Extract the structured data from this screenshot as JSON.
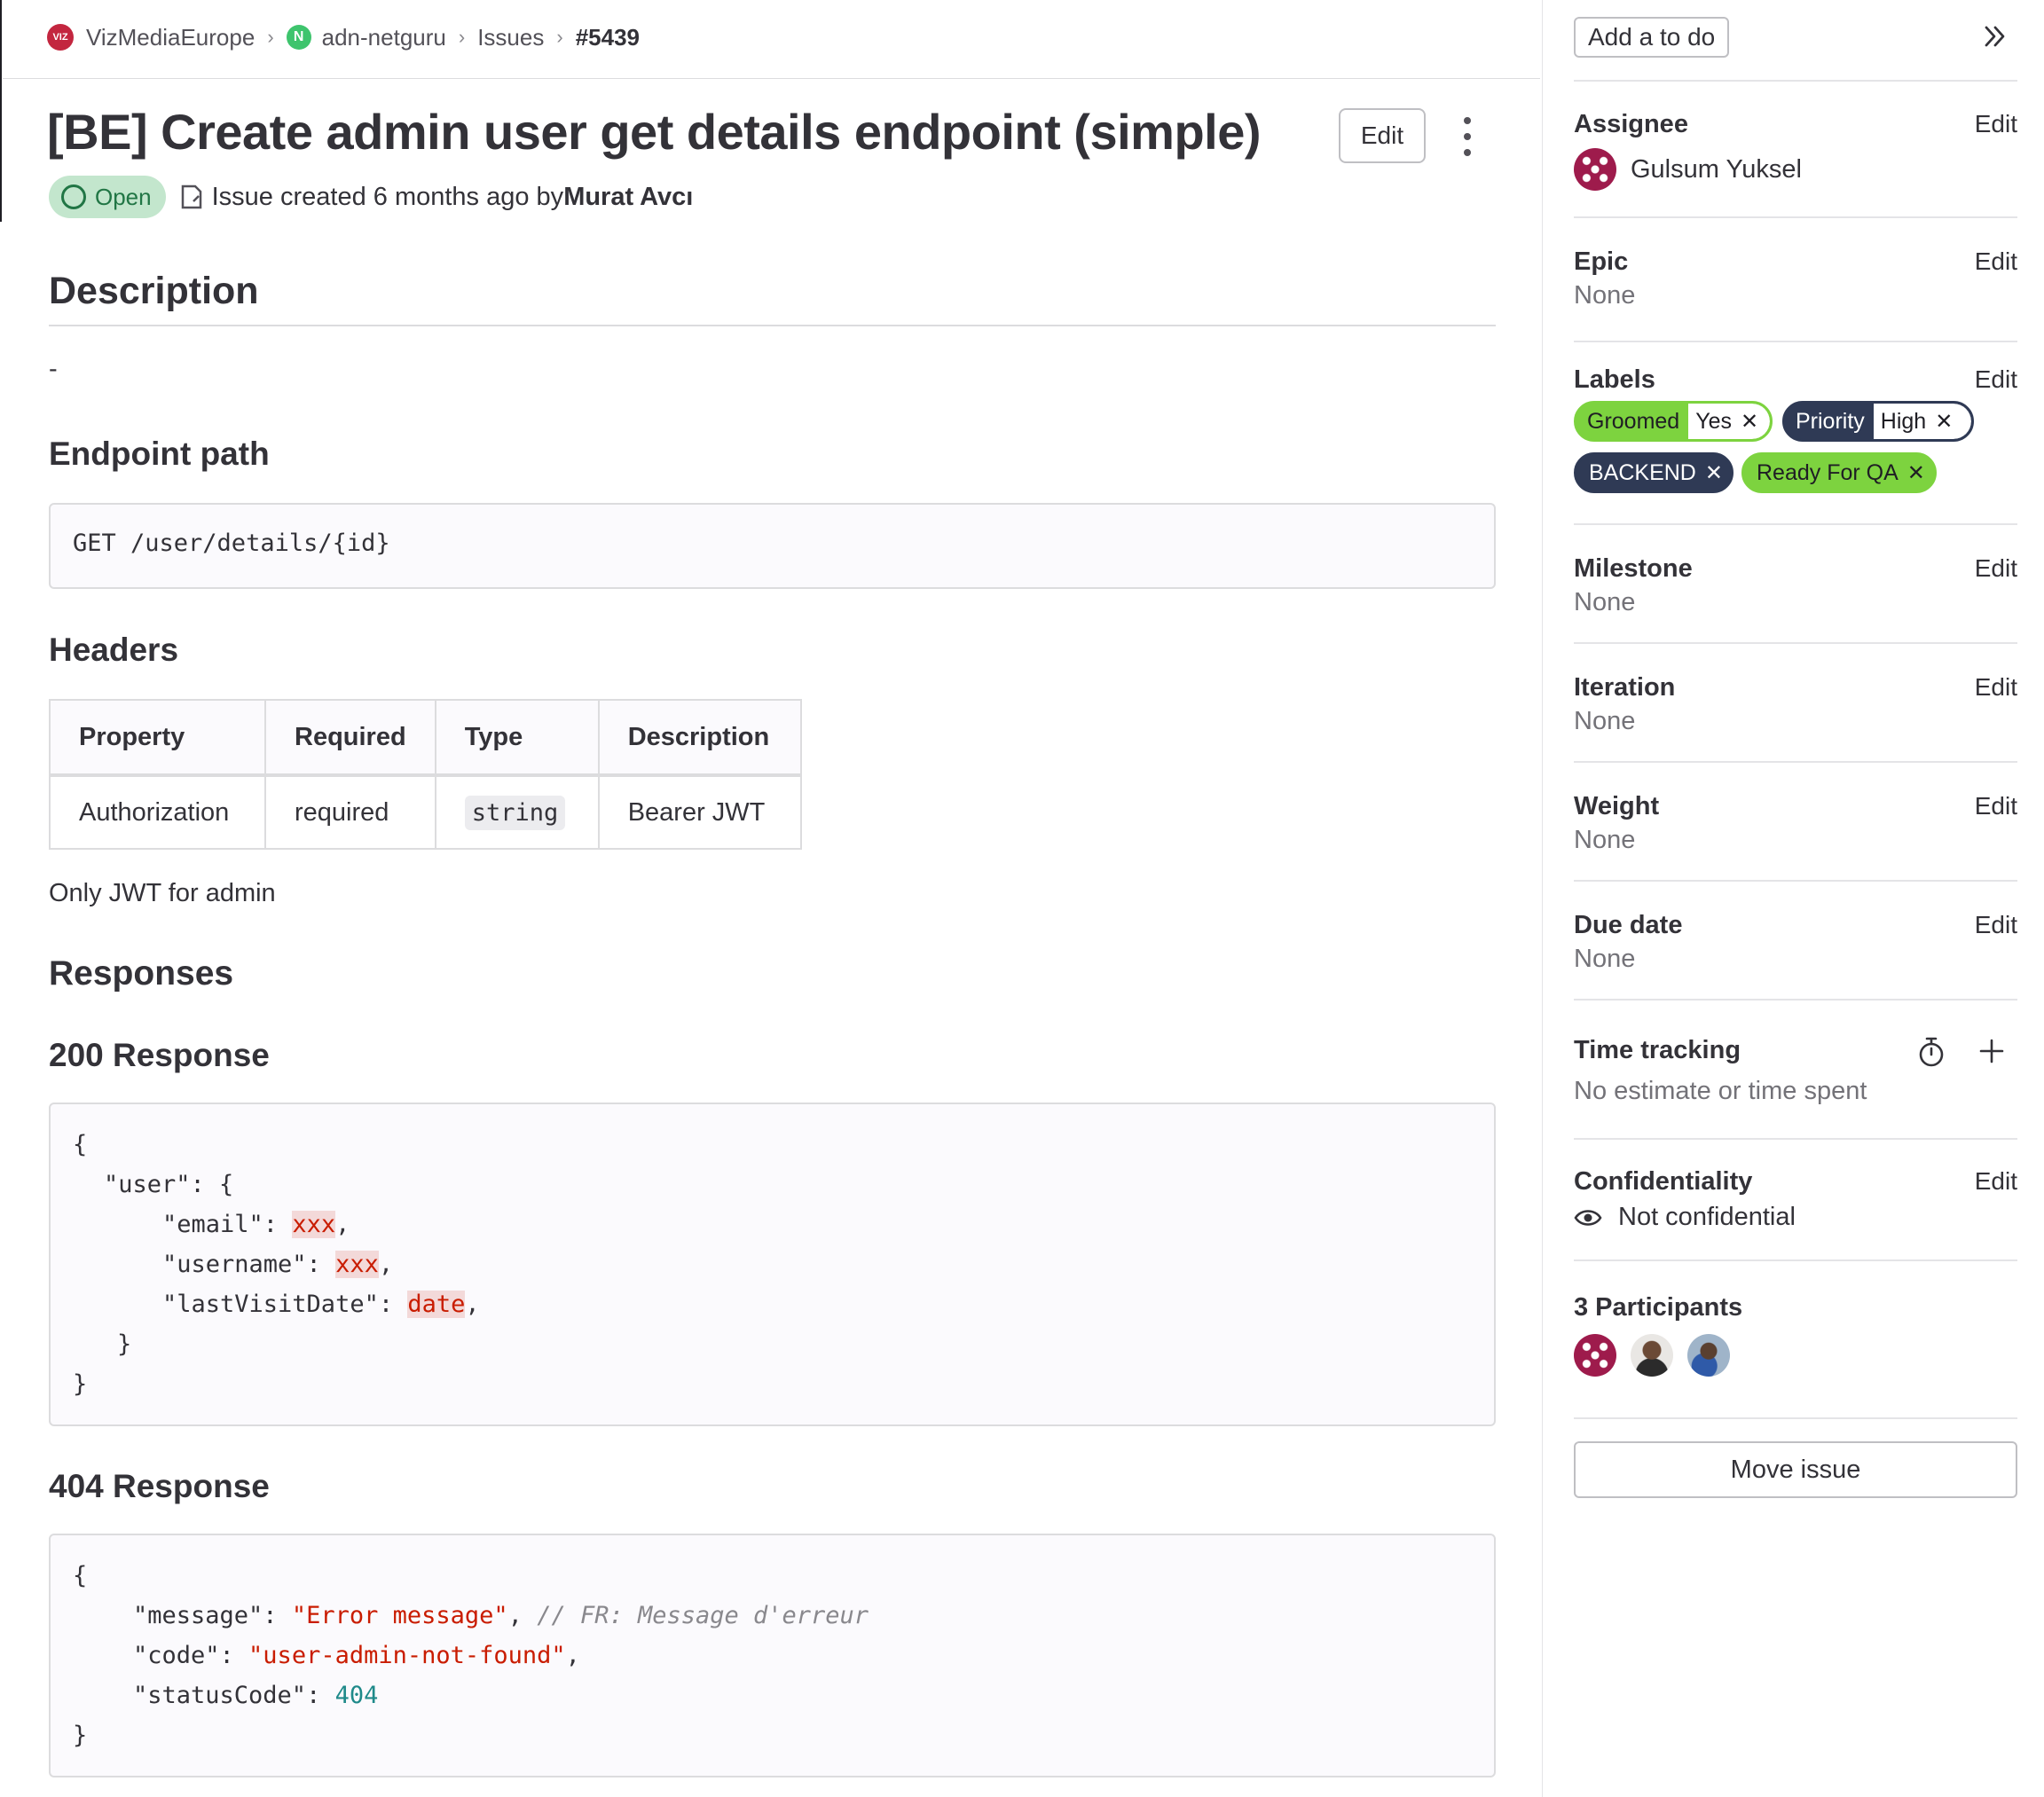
{
  "breadcrumb": {
    "group": "VizMediaEurope",
    "group_logo_text": "VIZ",
    "project": "adn-netguru",
    "project_initial": "N",
    "section": "Issues",
    "issue_ref": "#5439"
  },
  "issue": {
    "title": "[BE] Create admin user get details endpoint (simple)",
    "edit_label": "Edit",
    "status": "Open",
    "created_text": "Issue created 6 months ago by ",
    "author": "Murat Avcı"
  },
  "description": {
    "heading": "Description",
    "dash": "-",
    "endpoint_heading": "Endpoint path",
    "endpoint_code": "GET /user/details/{id}",
    "headers_heading": "Headers",
    "table": {
      "columns": [
        "Property",
        "Required",
        "Type",
        "Description"
      ],
      "rows": [
        [
          "Authorization",
          "required",
          "string",
          "Bearer JWT"
        ]
      ]
    },
    "jwt_note": "Only JWT for admin",
    "responses_heading": "Responses",
    "r200_heading": "200 Response",
    "r200": {
      "l1": "{",
      "l2": "\"user\": {",
      "email_key": "\"email\": ",
      "email_val": "xxx",
      "username_key": "\"username\": ",
      "username_val": "xxx",
      "lvd_key": "\"lastVisitDate\": ",
      "lvd_val": "date",
      "comma": ",",
      "l6": "}",
      "l7": "}"
    },
    "r404_heading": "404 Response",
    "r404": {
      "l1": "{",
      "message_key": "\"message\": ",
      "message_val": "\"Error message\"",
      "message_comment": "// FR: Message d'erreur",
      "code_key": "\"code\": ",
      "code_val": "\"user-admin-not-found\"",
      "status_key": "\"statusCode\": ",
      "status_val": "404",
      "comma": ",",
      "l5": "}"
    }
  },
  "sidebar": {
    "todo_label": "Add a to do",
    "edit_label": "Edit",
    "assignee": {
      "title": "Assignee",
      "name": "Gulsum Yuksel"
    },
    "epic": {
      "title": "Epic",
      "value": "None"
    },
    "labels": {
      "title": "Labels",
      "items": [
        {
          "key": "Groomed",
          "value": "Yes"
        },
        {
          "key": "Priority",
          "value": "High"
        },
        {
          "key": "BACKEND"
        },
        {
          "key": "Ready For QA"
        }
      ],
      "colors": {
        "green": "#7dd33f",
        "dark": "#2f3a55"
      }
    },
    "milestone": {
      "title": "Milestone",
      "value": "None"
    },
    "iteration": {
      "title": "Iteration",
      "value": "None"
    },
    "weight": {
      "title": "Weight",
      "value": "None"
    },
    "due_date": {
      "title": "Due date",
      "value": "None"
    },
    "time_tracking": {
      "title": "Time tracking",
      "value": "No estimate or time spent"
    },
    "confidentiality": {
      "title": "Confidentiality",
      "value": "Not confidential"
    },
    "participants": {
      "title": "3 Participants"
    },
    "move_label": "Move issue"
  }
}
